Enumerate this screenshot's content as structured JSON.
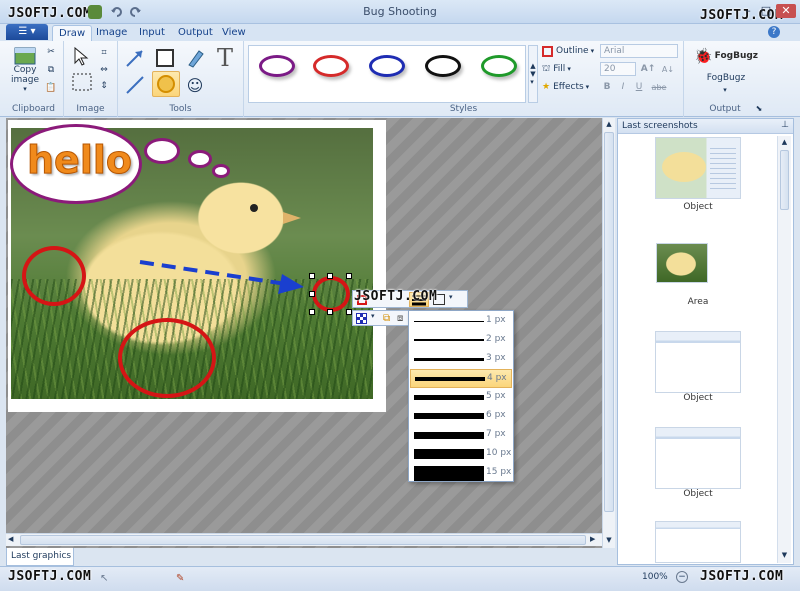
{
  "window": {
    "title": "Bug Shooting"
  },
  "watermark": "JSOFTJ.COM",
  "tabs": [
    "Draw",
    "Image",
    "Input",
    "Output",
    "View"
  ],
  "active_tab": "Draw",
  "ribbon": {
    "clipboard": {
      "copy_label": "Copy",
      "image_label": "image",
      "group": "Clipboard"
    },
    "image_group": "Image",
    "tools_group": "Tools",
    "styles_group": "Styles",
    "output_group": "Output",
    "style_colors": [
      "#7b1a86",
      "#d52a2a",
      "#1f2db3",
      "#111111",
      "#1f9a2a"
    ],
    "outline_label": "Outline",
    "fill_label": "Fill",
    "effects_label": "Effects",
    "font_name": "Arial",
    "font_size": "20",
    "format_buttons": [
      "B",
      "I",
      "U",
      "abe"
    ],
    "fogbugz_logo": "FogBugz",
    "fogbugz_label": "FogBugz"
  },
  "canvas": {
    "bubble_text": "hello",
    "arrow_color": "#1a3fcf",
    "circle_color": "#d51515"
  },
  "line_width_menu": {
    "items": [
      "1 px",
      "2 px",
      "3 px",
      "4 px",
      "5 px",
      "6 px",
      "7 px",
      "10 px",
      "15 px"
    ],
    "selected": "4 px"
  },
  "last_screenshots": {
    "title": "Last screenshots",
    "items": [
      {
        "caption": "Object",
        "kind": "chick-ui"
      },
      {
        "caption": "Area",
        "kind": "chick"
      },
      {
        "caption": "Object",
        "kind": "ui"
      },
      {
        "caption": "Object",
        "kind": "ui"
      },
      {
        "caption": "",
        "kind": "ui"
      }
    ]
  },
  "bottom_tab": "Last graphics",
  "status": {
    "zoom": "100%"
  }
}
